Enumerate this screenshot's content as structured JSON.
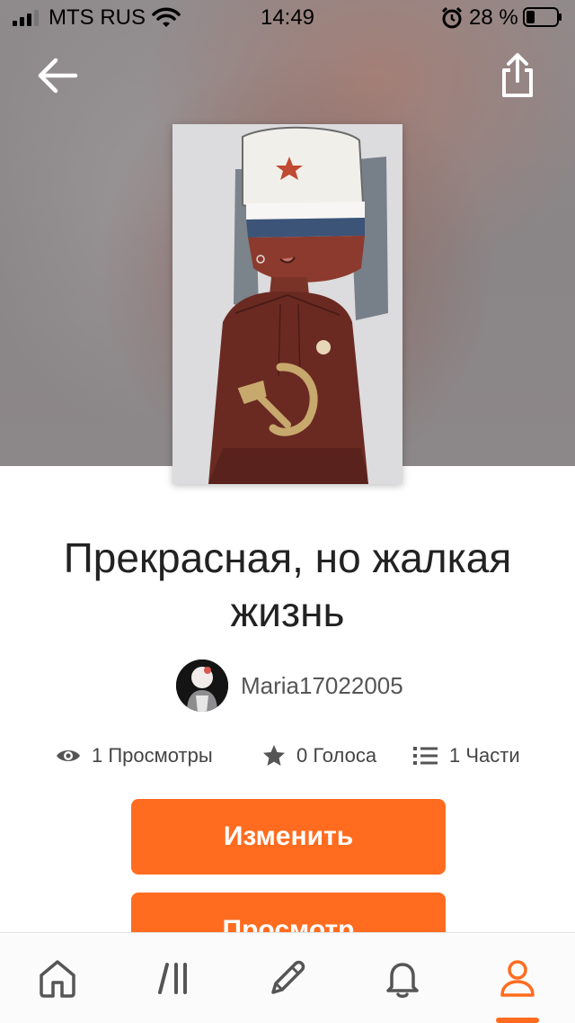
{
  "status_bar": {
    "carrier": "MTS RUS",
    "time": "14:49",
    "battery_percent": "28 %"
  },
  "header": {
    "back_icon": "arrow-left-icon",
    "share_icon": "share-icon"
  },
  "story": {
    "title": "Прекрасная, но жалкая жизнь",
    "author": "Maria17022005",
    "stats": {
      "views": "1 Просмотры",
      "votes": "0 Голоса",
      "parts": "1 Части"
    }
  },
  "actions": {
    "edit_label": "Изменить",
    "view_label": "Просмотр"
  },
  "tabs": [
    {
      "name": "home",
      "icon": "home-icon"
    },
    {
      "name": "library",
      "icon": "library-icon"
    },
    {
      "name": "write",
      "icon": "pencil-icon"
    },
    {
      "name": "notifications",
      "icon": "bell-icon"
    },
    {
      "name": "profile",
      "icon": "profile-icon",
      "active": true
    }
  ],
  "colors": {
    "accent": "#ff6c1f",
    "text": "#222222"
  }
}
